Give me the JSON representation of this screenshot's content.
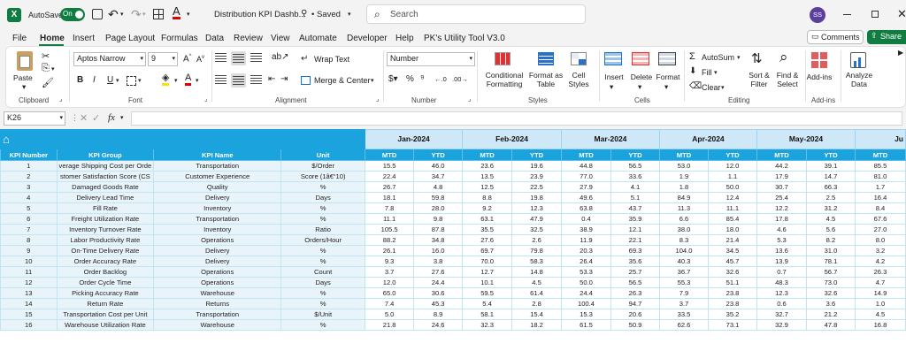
{
  "titlebar": {
    "autosave_label": "AutoSave",
    "autosave_state": "On",
    "filename": "Distribution KPI Dashb...",
    "saved_status": "• Saved",
    "search_placeholder": "Search",
    "user_initials": "SS"
  },
  "menu": {
    "tabs": [
      "File",
      "Home",
      "Insert",
      "Page Layout",
      "Formulas",
      "Data",
      "Review",
      "View",
      "Automate",
      "Developer",
      "Help",
      "PK's Utility Tool V3.0"
    ],
    "active": "Home",
    "comments_label": "Comments",
    "share_label": "Share"
  },
  "ribbon": {
    "clipboard": {
      "paste": "Paste",
      "group": "Clipboard"
    },
    "font": {
      "name": "Aptos Narrow",
      "size": "9",
      "group": "Font",
      "bold": "B",
      "italic": "I",
      "underline": "U",
      "font_color_glyph": "A"
    },
    "alignment": {
      "wrap": "Wrap Text",
      "merge": "Merge & Center",
      "group": "Alignment"
    },
    "number": {
      "format": "Number",
      "group": "Number"
    },
    "styles": {
      "conditional": "Conditional Formatting",
      "format_table": "Format as Table",
      "cell_styles": "Cell Styles",
      "group": "Styles"
    },
    "cells": {
      "insert": "Insert",
      "delete": "Delete",
      "format": "Format",
      "group": "Cells"
    },
    "editing": {
      "autosum": "AutoSum",
      "fill": "Fill",
      "clear": "Clear",
      "sort": "Sort & Filter",
      "find": "Find & Select",
      "group": "Editing"
    },
    "addins": {
      "addins": "Add-ins",
      "group": "Add-ins",
      "analyze": "Analyze Data"
    }
  },
  "formula_bar": {
    "name_box": "K26",
    "fx": "fx",
    "value": ""
  },
  "sheet": {
    "headers": {
      "kpi_number": "KPI Number",
      "kpi_group": "KPI Group",
      "kpi_name": "KPI Name",
      "unit": "Unit"
    },
    "months": [
      "Jan-2024",
      "Feb-2024",
      "Mar-2024",
      "Apr-2024",
      "May-2024",
      "Ju"
    ],
    "sub": {
      "mtd": "MTD",
      "ytd": "YTD"
    },
    "rows": [
      {
        "n": "1",
        "group": "verage Shipping Cost per Orde",
        "name": "Transportation",
        "unit": "$/Order",
        "vals": [
          "15.5",
          "46.0",
          "23.6",
          "19.6",
          "44.8",
          "56.5",
          "53.0",
          "12.0",
          "44.2",
          "39.1",
          "85.5"
        ]
      },
      {
        "n": "2",
        "group": "stomer Satisfaction Score (CS",
        "name": "Customer Experience",
        "unit": "Score (1â€“10)",
        "vals": [
          "22.4",
          "34.7",
          "13.5",
          "23.9",
          "77.0",
          "33.6",
          "1.9",
          "1.1",
          "17.9",
          "14.7",
          "81.0"
        ]
      },
      {
        "n": "3",
        "group": "Damaged Goods Rate",
        "name": "Quality",
        "unit": "%",
        "vals": [
          "26.7",
          "4.8",
          "12.5",
          "22.5",
          "27.9",
          "4.1",
          "1.8",
          "50.0",
          "30.7",
          "66.3",
          "1.7"
        ]
      },
      {
        "n": "4",
        "group": "Delivery Lead Time",
        "name": "Delivery",
        "unit": "Days",
        "vals": [
          "18.1",
          "59.8",
          "8.8",
          "19.8",
          "49.6",
          "5.1",
          "84.9",
          "12.4",
          "25.4",
          "2.5",
          "16.4"
        ]
      },
      {
        "n": "5",
        "group": "Fill Rate",
        "name": "Inventory",
        "unit": "%",
        "vals": [
          "7.8",
          "28.0",
          "9.2",
          "12.3",
          "63.8",
          "43.7",
          "11.3",
          "11.1",
          "12.2",
          "31.2",
          "8.4"
        ]
      },
      {
        "n": "6",
        "group": "Freight Utilization Rate",
        "name": "Transportation",
        "unit": "%",
        "vals": [
          "11.1",
          "9.8",
          "63.1",
          "47.9",
          "0.4",
          "35.9",
          "6.6",
          "85.4",
          "17.8",
          "4.5",
          "67.6"
        ]
      },
      {
        "n": "7",
        "group": "Inventory Turnover Rate",
        "name": "Inventory",
        "unit": "Ratio",
        "vals": [
          "105.5",
          "87.8",
          "35.5",
          "32.5",
          "38.9",
          "12.1",
          "38.0",
          "18.0",
          "4.6",
          "5.6",
          "27.0"
        ]
      },
      {
        "n": "8",
        "group": "Labor Productivity Rate",
        "name": "Operations",
        "unit": "Orders/Hour",
        "vals": [
          "88.2",
          "34.8",
          "27.6",
          "2.6",
          "11.9",
          "22.1",
          "8.3",
          "21.4",
          "5.3",
          "8.2",
          "8.0"
        ]
      },
      {
        "n": "9",
        "group": "On-Time Delivery Rate",
        "name": "Delivery",
        "unit": "%",
        "vals": [
          "26.1",
          "16.0",
          "69.7",
          "79.8",
          "20.3",
          "69.3",
          "104.0",
          "34.5",
          "13.6",
          "31.0",
          "3.2"
        ]
      },
      {
        "n": "10",
        "group": "Order Accuracy Rate",
        "name": "Delivery",
        "unit": "%",
        "vals": [
          "9.3",
          "3.8",
          "70.0",
          "58.3",
          "26.4",
          "35.6",
          "40.3",
          "45.7",
          "13.9",
          "78.1",
          "4.2"
        ]
      },
      {
        "n": "11",
        "group": "Order Backlog",
        "name": "Operations",
        "unit": "Count",
        "vals": [
          "3.7",
          "27.6",
          "12.7",
          "14.8",
          "53.3",
          "25.7",
          "36.7",
          "32.6",
          "0.7",
          "56.7",
          "26.3"
        ]
      },
      {
        "n": "12",
        "group": "Order Cycle Time",
        "name": "Operations",
        "unit": "Days",
        "vals": [
          "12.0",
          "24.4",
          "10.1",
          "4.5",
          "50.0",
          "56.5",
          "55.3",
          "51.1",
          "48.3",
          "73.0",
          "4.7"
        ]
      },
      {
        "n": "13",
        "group": "Picking Accuracy Rate",
        "name": "Warehouse",
        "unit": "%",
        "vals": [
          "65.0",
          "30.6",
          "59.5",
          "61.4",
          "24.4",
          "26.3",
          "7.9",
          "23.8",
          "12.3",
          "32.6",
          "14.9"
        ]
      },
      {
        "n": "14",
        "group": "Return Rate",
        "name": "Returns",
        "unit": "%",
        "vals": [
          "7.4",
          "45.3",
          "5.4",
          "2.8",
          "100.4",
          "94.7",
          "3.7",
          "23.8",
          "0.6",
          "3.6",
          "1.0"
        ]
      },
      {
        "n": "15",
        "group": "Transportation Cost per Unit",
        "name": "Transportation",
        "unit": "$/Unit",
        "vals": [
          "5.0",
          "8.9",
          "58.1",
          "15.4",
          "15.3",
          "20.6",
          "33.5",
          "35.2",
          "32.7",
          "21.2",
          "4.5"
        ]
      },
      {
        "n": "16",
        "group": "Warehouse Utilization Rate",
        "name": "Warehouse",
        "unit": "%",
        "vals": [
          "21.8",
          "24.6",
          "32.3",
          "18.2",
          "61.5",
          "50.9",
          "62.6",
          "73.1",
          "32.9",
          "47.8",
          "16.8"
        ]
      }
    ]
  },
  "colors": {
    "excel_green": "#107c41",
    "header_blue": "#1aa3dc",
    "month_bg": "#cfe8f7"
  }
}
